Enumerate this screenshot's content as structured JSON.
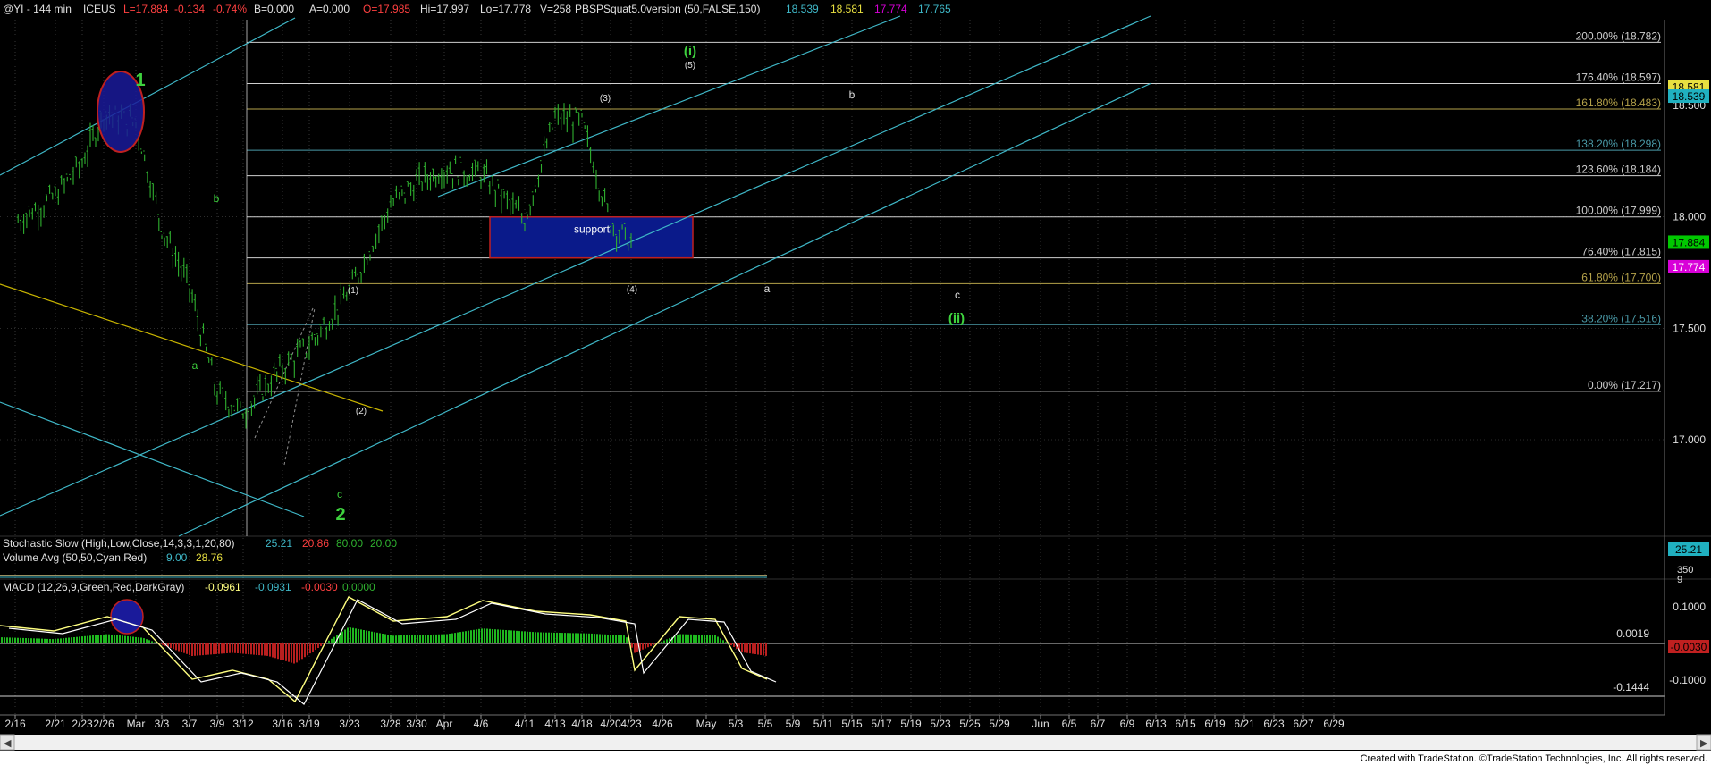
{
  "header": {
    "symbol": "@YI - 144 min",
    "exchange": "ICEUS",
    "last": "L=17.884",
    "change": "-0.134",
    "change_pct": "-0.74%",
    "b": "B=0.000",
    "a": "A=0.000",
    "open": "O=17.985",
    "hi": "Hi=17.997",
    "lo": "Lo=17.778",
    "vol": "V=258",
    "indicator": "PBSPSquat5.0version (50,FALSE,150)",
    "values": [
      "18.539",
      "18.581",
      "17.774",
      "17.765"
    ]
  },
  "colors": {
    "background": "#000000",
    "grid": "#5a5a5a",
    "bars": "#2fb12f",
    "channel": "#3fb8c8",
    "fib_white": "#cfcfcf",
    "fib_gold": "#b5a24a",
    "fib_teal": "#4a9aa8",
    "wave_green": "#3ed23e",
    "support_fill": "#0a1a8a",
    "support_border": "#c02020",
    "trend_yellow": "#c8b400",
    "stoch_k": "#3fb8c8",
    "stoch_d": "#ff4040",
    "macd_line": "#ffff80",
    "macd_signal": "#ffffff",
    "macd_hist_pos": "#1fb81f",
    "macd_hist_neg": "#b81f1f",
    "tag_green": "#00c800",
    "tag_magenta": "#d800d8",
    "tag_cyan": "#20b0c0"
  },
  "chart_data": {
    "type": "bar",
    "title": "@YI - 144 min ICEUS",
    "price_axis_ticks": [
      "17.000",
      "17.500",
      "18.000",
      "18.500"
    ],
    "price_axis_tags": [
      {
        "value": "18.581",
        "color": "yellow"
      },
      {
        "value": "18.539",
        "color": "cyan"
      },
      {
        "value": "17.884",
        "color": "green"
      },
      {
        "value": "17.774",
        "color": "magenta"
      }
    ],
    "date_axis_ticks": [
      "2/16",
      "2/21",
      "2/23",
      "2/26",
      "Mar",
      "3/3",
      "3/7",
      "3/9",
      "3/12",
      "3/16",
      "3/19",
      "3/23",
      "3/28",
      "3/30",
      "Apr",
      "4/6",
      "4/11",
      "4/13",
      "4/18",
      "4/20",
      "4/23",
      "4/26",
      "May",
      "5/3",
      "5/5",
      "5/9",
      "5/11",
      "5/15",
      "5/17",
      "5/19",
      "5/23",
      "5/25",
      "5/29",
      "Jun",
      "6/5",
      "6/7",
      "6/9",
      "6/13",
      "6/15",
      "6/19",
      "6/21",
      "6/23",
      "6/27",
      "6/29"
    ],
    "price_series": [
      [
        "2/16",
        17.97
      ],
      [
        "2/21",
        18.09
      ],
      [
        "2/23",
        18.24
      ],
      [
        "2/26",
        18.46
      ],
      [
        "Mar",
        18.42
      ],
      [
        "3/3",
        17.95
      ],
      [
        "3/7",
        17.68
      ],
      [
        "3/9",
        17.2
      ],
      [
        "3/12",
        17.12
      ],
      [
        "3/16",
        17.32
      ],
      [
        "3/19",
        17.42
      ],
      [
        "3/23",
        17.66
      ],
      [
        "3/28",
        18.05
      ],
      [
        "3/30",
        18.15
      ],
      [
        "Apr",
        18.21
      ],
      [
        "4/6",
        18.19
      ],
      [
        "4/11",
        17.98
      ],
      [
        "4/13",
        18.44
      ],
      [
        "4/18",
        18.42
      ],
      [
        "4/20",
        17.97
      ],
      [
        "4/23",
        17.88
      ]
    ],
    "fib_levels": [
      {
        "label": "200.00% (18.782)",
        "value": 18.782
      },
      {
        "label": "176.40% (18.597)",
        "value": 18.597
      },
      {
        "label": "161.80% (18.483)",
        "value": 18.483
      },
      {
        "label": "138.20% (18.298)",
        "value": 18.298
      },
      {
        "label": "123.60% (18.184)",
        "value": 18.184
      },
      {
        "label": "100.00% (17.999)",
        "value": 17.999
      },
      {
        "label": "76.40% (17.815)",
        "value": 17.815
      },
      {
        "label": "61.80% (17.700)",
        "value": 17.7
      },
      {
        "label": "38.20% (17.516)",
        "value": 17.516
      },
      {
        "label": "0.00% (17.217)",
        "value": 17.217
      }
    ],
    "support_box": {
      "label": "support"
    },
    "wave_labels": {
      "big_green": [
        {
          "text": "1"
        },
        {
          "text": "2"
        }
      ],
      "circled_green": [
        {
          "text": "(i)"
        },
        {
          "text": "(ii)"
        }
      ],
      "small_green": [
        {
          "text": "b"
        },
        {
          "text": "a"
        },
        {
          "text": "c"
        }
      ],
      "white_parens": [
        {
          "text": "(1)"
        },
        {
          "text": "(2)"
        },
        {
          "text": "(3)"
        },
        {
          "text": "(4)"
        },
        {
          "text": "(5)"
        }
      ],
      "white_letters": [
        {
          "text": "a"
        },
        {
          "text": "b"
        },
        {
          "text": "c"
        }
      ]
    },
    "stochastic": {
      "label": "Stochastic Slow (High,Low,Close,14,3,3,1,20,80)",
      "values": [
        "25.21",
        "20.86",
        "80.00",
        "20.00"
      ],
      "axis_tag": "25.21"
    },
    "volume_avg": {
      "label": "Volume Avg (50,50,Cyan,Red)",
      "values": [
        "9.00",
        "28.76"
      ],
      "axis_labels": [
        "350",
        "9"
      ]
    },
    "macd": {
      "label": "MACD (12,26,9,Green,Red,DarkGray)",
      "values": [
        "-0.0961",
        "-0.0931",
        "-0.0030",
        "0.0000"
      ],
      "axis_ticks": [
        "0.1000",
        "-0.1000"
      ],
      "axis_tag": "-0.0030",
      "level_labels": [
        "0.0019",
        "-0.1444"
      ]
    }
  },
  "footer": {
    "credit": "Created with TradeStation. ©TradeStation Technologies, Inc. All rights reserved."
  }
}
